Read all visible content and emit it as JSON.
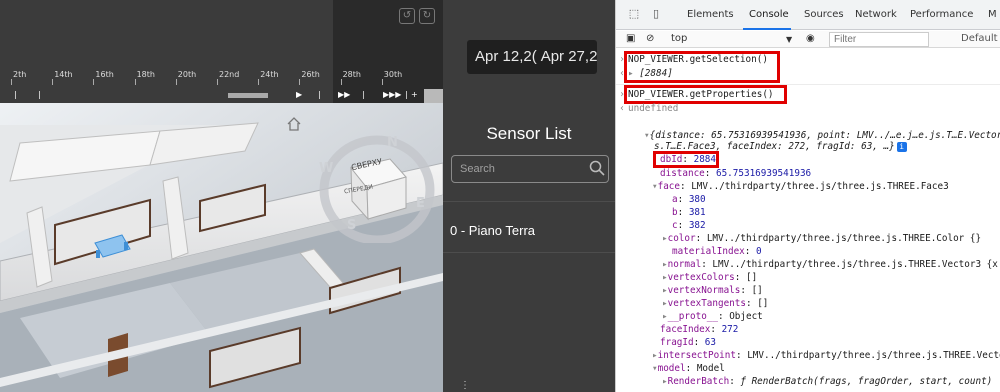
{
  "timeline": {
    "tick_labels": [
      "2th",
      "14th",
      "16th",
      "18th",
      "20th",
      "22nd",
      "24th",
      "26th",
      "28th",
      "30th"
    ],
    "controls": [
      "|",
      "|",
      "▶",
      "|",
      "▶▶",
      "|",
      "▶▶▶",
      "|",
      "+"
    ]
  },
  "viewcube": {
    "top_label": "СВЕРХУ",
    "side_label": "СПЕРЕДИ",
    "compass": {
      "n": "N",
      "e": "E",
      "s": "S",
      "w": "W"
    }
  },
  "sensor_panel": {
    "date_start": "Apr 12,2(",
    "date_end": "Apr 27,2",
    "title": "Sensor List",
    "search_placeholder": "Search",
    "items": [
      "0 - Piano Terra"
    ],
    "more": "⋮"
  },
  "devtools": {
    "tabs": [
      "Elements",
      "Console",
      "Sources",
      "Network",
      "Performance",
      "M"
    ],
    "active_tab": "Console",
    "toolbar": {
      "context": "top",
      "filter_placeholder": "Filter",
      "levels": "Default l"
    },
    "console_lines": {
      "cmd1": "NOP_VIEWER.getSelection()",
      "res1": "[2884]",
      "cmd2": "NOP_VIEWER.getProperties()",
      "res2": "undefined",
      "obj_summary": "{distance: 65.75316939541936, point: LMV../…e.j…e.js.T…E.Vector3",
      "obj_summary2": "s.T…E.Face3, faceIndex: 272, fragId: 63, …}",
      "dbid_key": "dbId",
      "dbid_val": "2884",
      "distance_key": "distance",
      "distance_val": "65.75316939541936",
      "face_key": "face",
      "face_val": "LMV../thirdparty/three.js/three.js.THREE.Face3",
      "a_key": "a",
      "a_val": "380",
      "b_key": "b",
      "b_val": "381",
      "c_key": "c",
      "c_val": "382",
      "color_key": "color",
      "color_val": "LMV../thirdparty/three.js/three.js.THREE.Color {}",
      "mi_key": "materialIndex",
      "mi_val": "0",
      "normal_key": "normal",
      "normal_val": "LMV../thirdparty/three.js/three.js.THREE.Vector3 {x:",
      "vc_key": "vertexColors",
      "vc_val": "[]",
      "vn_key": "vertexNormals",
      "vn_val": "[]",
      "vt_key": "vertexTangents",
      "vt_val": "[]",
      "proto_key": "__proto__",
      "proto_val": "Object",
      "fi_key": "faceIndex",
      "fi_val": "272",
      "fr_key": "fragId",
      "fr_val": "63",
      "ip_key": "intersectPoint",
      "ip_val": "LMV../thirdparty/three.js/three.js.THREE.Vecto",
      "model_key": "model",
      "model_val": "Model",
      "rb_key": "RenderBatch",
      "rb_val": "ƒ RenderBatch(frags, fragOrder, start, count)"
    }
  },
  "colors": {
    "highlight": "#e00000",
    "console_key": "#881391",
    "console_number": "#1a1aa6",
    "active_tab": "#1a73e8"
  }
}
